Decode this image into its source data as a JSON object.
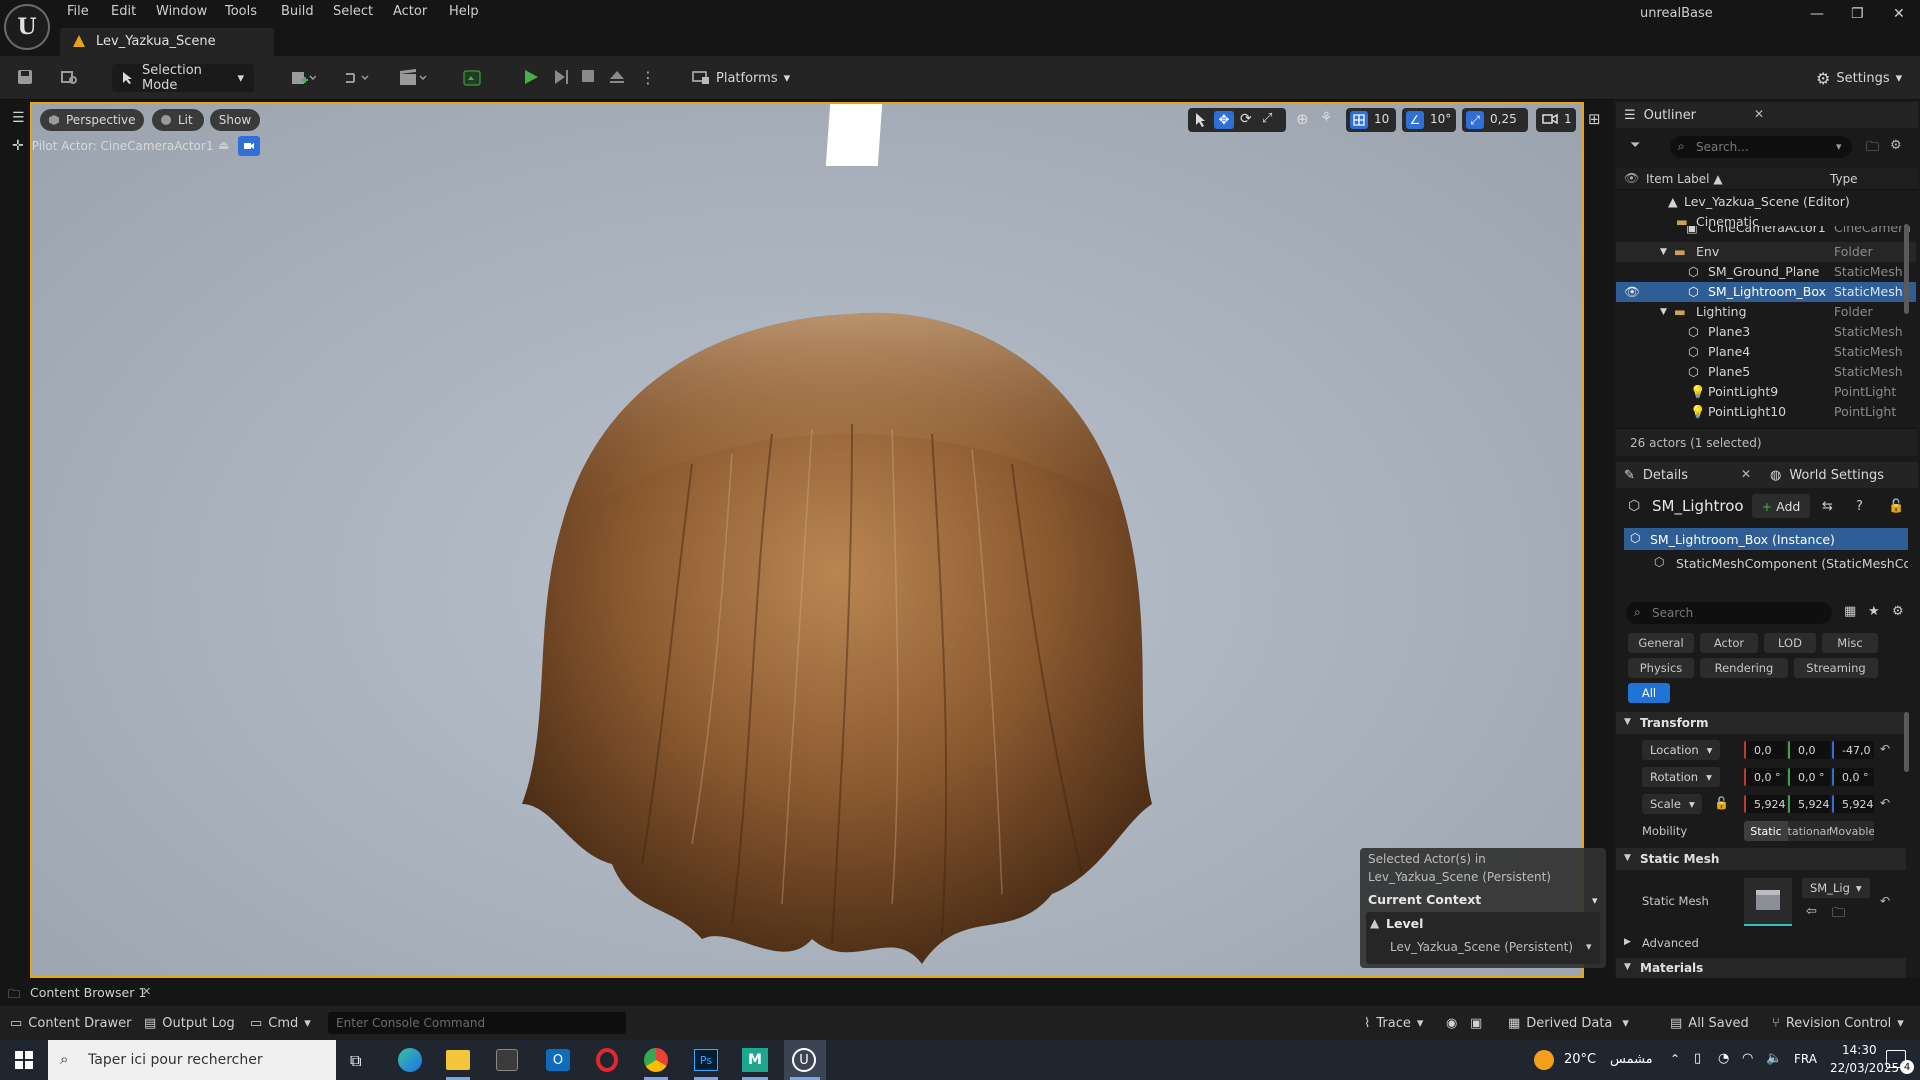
{
  "menu": {
    "items": [
      "File",
      "Edit",
      "Window",
      "Tools",
      "Build",
      "Select",
      "Actor",
      "Help"
    ],
    "level_tab": "Lev_Yazkua_Scene",
    "project_name": "unrealBase",
    "window_controls": [
      "—",
      "❐",
      "✕"
    ]
  },
  "toolbar": {
    "selection_mode": "Selection Mode",
    "platforms": "Platforms",
    "settings": "Settings"
  },
  "viewport": {
    "perspective": "Perspective",
    "lit": "Lit",
    "show": "Show",
    "pilot_actor": "Pilot Actor: CineCameraActor1",
    "grid_snap": "10",
    "rotation_snap": "10°",
    "scale_snap": "0,25",
    "camera_speed": "1"
  },
  "context_popup": {
    "selected_line1": "Selected Actor(s) in",
    "selected_line2": "Lev_Yazkua_Scene (Persistent)",
    "current_context": "Current Context",
    "level_label": "Level",
    "level_value": "Lev_Yazkua_Scene (Persistent)"
  },
  "outliner": {
    "tab": "Outliner",
    "search_placeholder": "Search...",
    "col_label": "Item Label ▲",
    "col_type": "Type",
    "rows": [
      {
        "label": "Lev_Yazkua_Scene (Editor)",
        "type": ""
      },
      {
        "label": "Cinematic",
        "type": ""
      },
      {
        "label": "CineCameraActor1",
        "type": "CineCamera"
      },
      {
        "label": "Env",
        "type": "Folder"
      },
      {
        "label": "SM_Ground_Plane",
        "type": "StaticMesh"
      },
      {
        "label": "SM_Lightroom_Box",
        "type": "StaticMesh"
      },
      {
        "label": "Lighting",
        "type": "Folder"
      },
      {
        "label": "Plane3",
        "type": "StaticMesh"
      },
      {
        "label": "Plane4",
        "type": "StaticMesh"
      },
      {
        "label": "Plane5",
        "type": "StaticMesh"
      },
      {
        "label": "PointLight9",
        "type": "PointLight"
      },
      {
        "label": "PointLight10",
        "type": "PointLight"
      }
    ],
    "footer": "26 actors (1 selected)"
  },
  "details": {
    "tab": "Details",
    "world_settings_tab": "World Settings",
    "actor_name": "SM_Lightroom_Box",
    "add_label": "Add",
    "instance_label": "SM_Lightroom_Box (Instance)",
    "component_label": "StaticMeshComponent (StaticMeshComp",
    "search_placeholder": "Search",
    "categories_row1": [
      "General",
      "Actor",
      "LOD",
      "Misc"
    ],
    "categories_row2": [
      "Physics",
      "Rendering",
      "Streaming"
    ],
    "all_label": "All",
    "transform_header": "Transform",
    "location_label": "Location",
    "location": [
      "0,0",
      "0,0",
      "-47,0"
    ],
    "rotation_label": "Rotation",
    "rotation": [
      "0,0 °",
      "0,0 °",
      "0,0 °"
    ],
    "scale_label": "Scale",
    "scale": [
      "5,924",
      "5,924",
      "5,924"
    ],
    "mobility_label": "Mobility",
    "mobility_options": [
      "Static",
      "Stationary",
      "Movable"
    ],
    "static_mesh_header": "Static Mesh",
    "static_mesh_label": "Static Mesh",
    "static_mesh_value": "SM_Lig",
    "advanced_label": "Advanced",
    "materials_header": "Materials"
  },
  "bottom": {
    "content_browser_tab": "Content Browser 1",
    "content_drawer": "Content Drawer",
    "output_log": "Output Log",
    "cmd": "Cmd",
    "console_placeholder": "Enter Console Command",
    "trace": "Trace",
    "derived_data": "Derived Data",
    "all_saved": "All Saved",
    "revision_control": "Revision Control"
  },
  "taskbar": {
    "search_placeholder": "Taper ici pour rechercher",
    "weather": "20°C",
    "weather_text": "مشمس",
    "language": "FRA",
    "time": "14:30",
    "date": "22/03/2025",
    "notification_count": "4"
  },
  "colors": {
    "accent_orange": "#e8a317",
    "selection_blue": "#2f5d95",
    "play_green": "#46b04a"
  }
}
